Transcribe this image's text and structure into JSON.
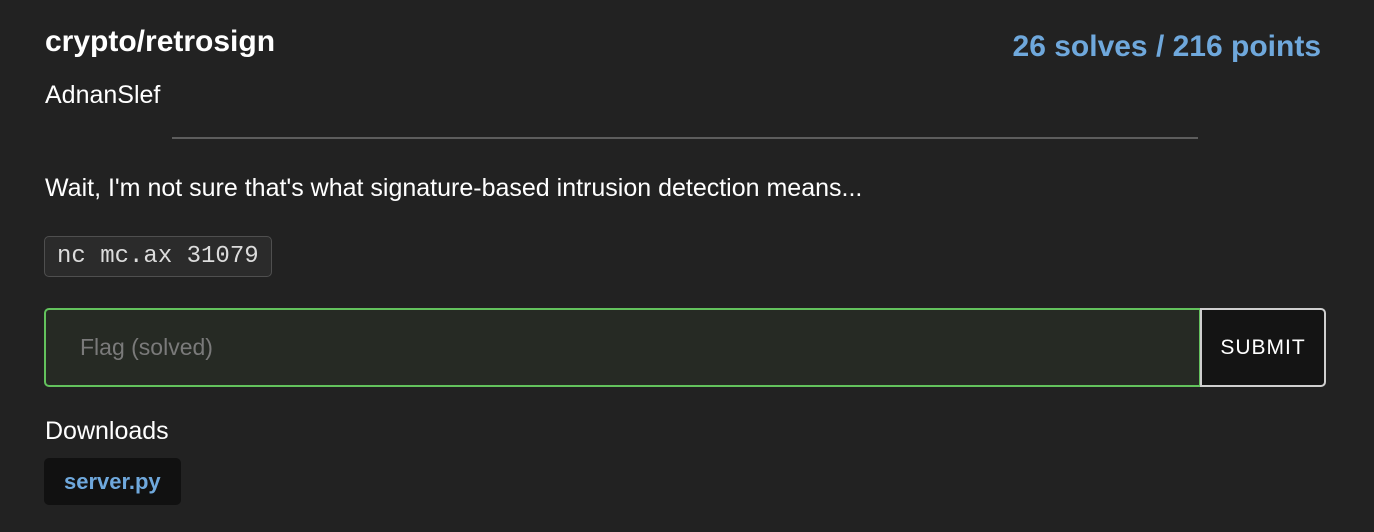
{
  "challenge": {
    "title": "crypto/retrosign",
    "score": "26 solves / 216 points",
    "author": "AdnanSlef",
    "description": "Wait, I'm not sure that's what signature-based intrusion detection means...",
    "connection": "nc mc.ax 31079"
  },
  "flag_form": {
    "placeholder": "Flag (solved)",
    "value": "",
    "submit_label": "SUBMIT"
  },
  "downloads": {
    "heading": "Downloads",
    "files": [
      {
        "name": "server.py"
      }
    ]
  },
  "colors": {
    "background": "#222222",
    "accent": "#6fa8dc",
    "solved_border": "#63c25d"
  }
}
